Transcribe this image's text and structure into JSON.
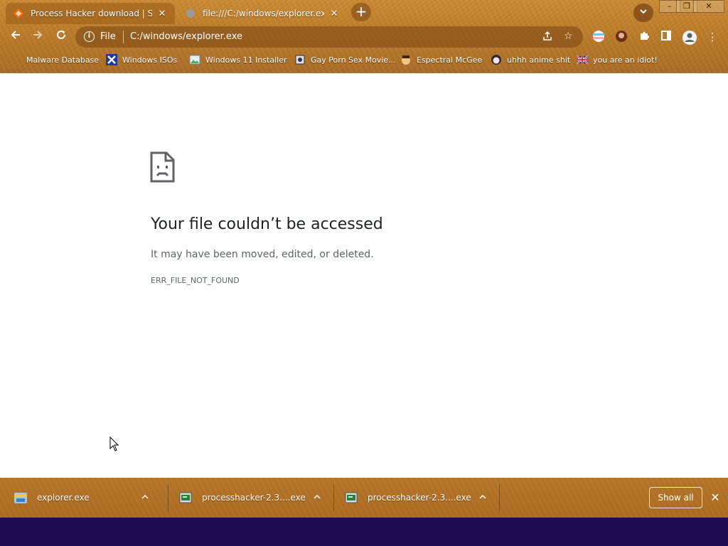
{
  "tabs": [
    {
      "title": "Process Hacker download | SourceForge",
      "active": true,
      "icon": "process-hacker-favicon"
    },
    {
      "title": "file:///C:/windows/explorer.exe",
      "active": false,
      "icon": "globe-icon"
    }
  ],
  "window_controls": {
    "minimize": "–",
    "restore": "❐",
    "close": "✕"
  },
  "toolbar": {
    "scheme_label": "File",
    "url": "C:/windows/explorer.exe"
  },
  "bookmarks": [
    {
      "label": "Malware Database",
      "icon": "blank-favicon"
    },
    {
      "label": "Windows ISOs",
      "icon": "x-favicon"
    },
    {
      "label": "Windows 11 Installer",
      "icon": "image-favicon"
    },
    {
      "label": "Gay Porn Sex Movie...",
      "icon": "site-favicon"
    },
    {
      "label": "Espectral McGee",
      "icon": "face-favicon"
    },
    {
      "label": "uhhh anime shit",
      "icon": "anime-favicon"
    },
    {
      "label": "you are an idiot!",
      "icon": "flag-favicon"
    }
  ],
  "error": {
    "title": "Your file couldn’t be accessed",
    "message": "It may have been moved, edited, or deleted.",
    "code": "ERR_FILE_NOT_FOUND"
  },
  "downloads": [
    {
      "name": "explorer.exe",
      "icon": "explorer-file-icon"
    },
    {
      "name": "processhacker-2.3....exe",
      "icon": "exe-file-icon"
    },
    {
      "name": "processhacker-2.3....exe",
      "icon": "exe-file-icon"
    }
  ],
  "download_shelf": {
    "show_all_label": "Show all"
  },
  "colors": {
    "chrome_accent": "#bf7f2c",
    "taskbar": "#1e0b4f"
  }
}
